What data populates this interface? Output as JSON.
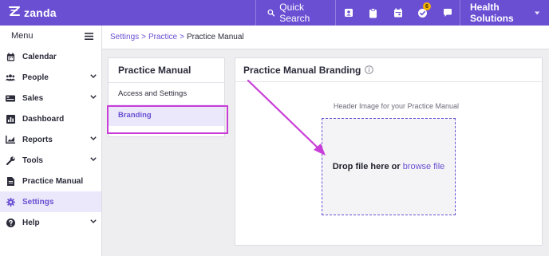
{
  "topbar": {
    "brand": "zanda",
    "quick_search": "Quick Search",
    "icons": [
      "contact-card-icon",
      "clipboard-icon",
      "calendar-icon",
      "task-check-icon",
      "chat-icon"
    ],
    "task_badge": "6",
    "organisation": "Health Solutions"
  },
  "sidebar": {
    "menu_label": "Menu",
    "items": [
      {
        "label": "Calendar",
        "icon": "calendar-icon"
      },
      {
        "label": "People",
        "icon": "people-icon"
      },
      {
        "label": "Sales",
        "icon": "sales-icon"
      },
      {
        "label": "Dashboard",
        "icon": "dashboard-icon"
      },
      {
        "label": "Reports",
        "icon": "reports-icon"
      },
      {
        "label": "Tools",
        "icon": "wrench-icon"
      },
      {
        "label": "Practice Manual",
        "icon": "document-icon"
      },
      {
        "label": "Settings",
        "icon": "gear-icon"
      },
      {
        "label": "Help",
        "icon": "help-icon"
      }
    ]
  },
  "breadcrumb": {
    "settings": "Settings",
    "sep": ">",
    "practice": "Practice",
    "current": "Practice Manual"
  },
  "subpanel": {
    "title": "Practice Manual",
    "items": [
      "Access and Settings",
      "Branding"
    ]
  },
  "main": {
    "title": "Practice Manual Branding",
    "upload_label": "Header Image for your Practice Manual",
    "drop_text": "Drop file here or",
    "browse_text": "browse file"
  },
  "colors": {
    "brand": "#6a4fd3",
    "highlight": "#c93ed8",
    "badge": "#f5b400"
  }
}
